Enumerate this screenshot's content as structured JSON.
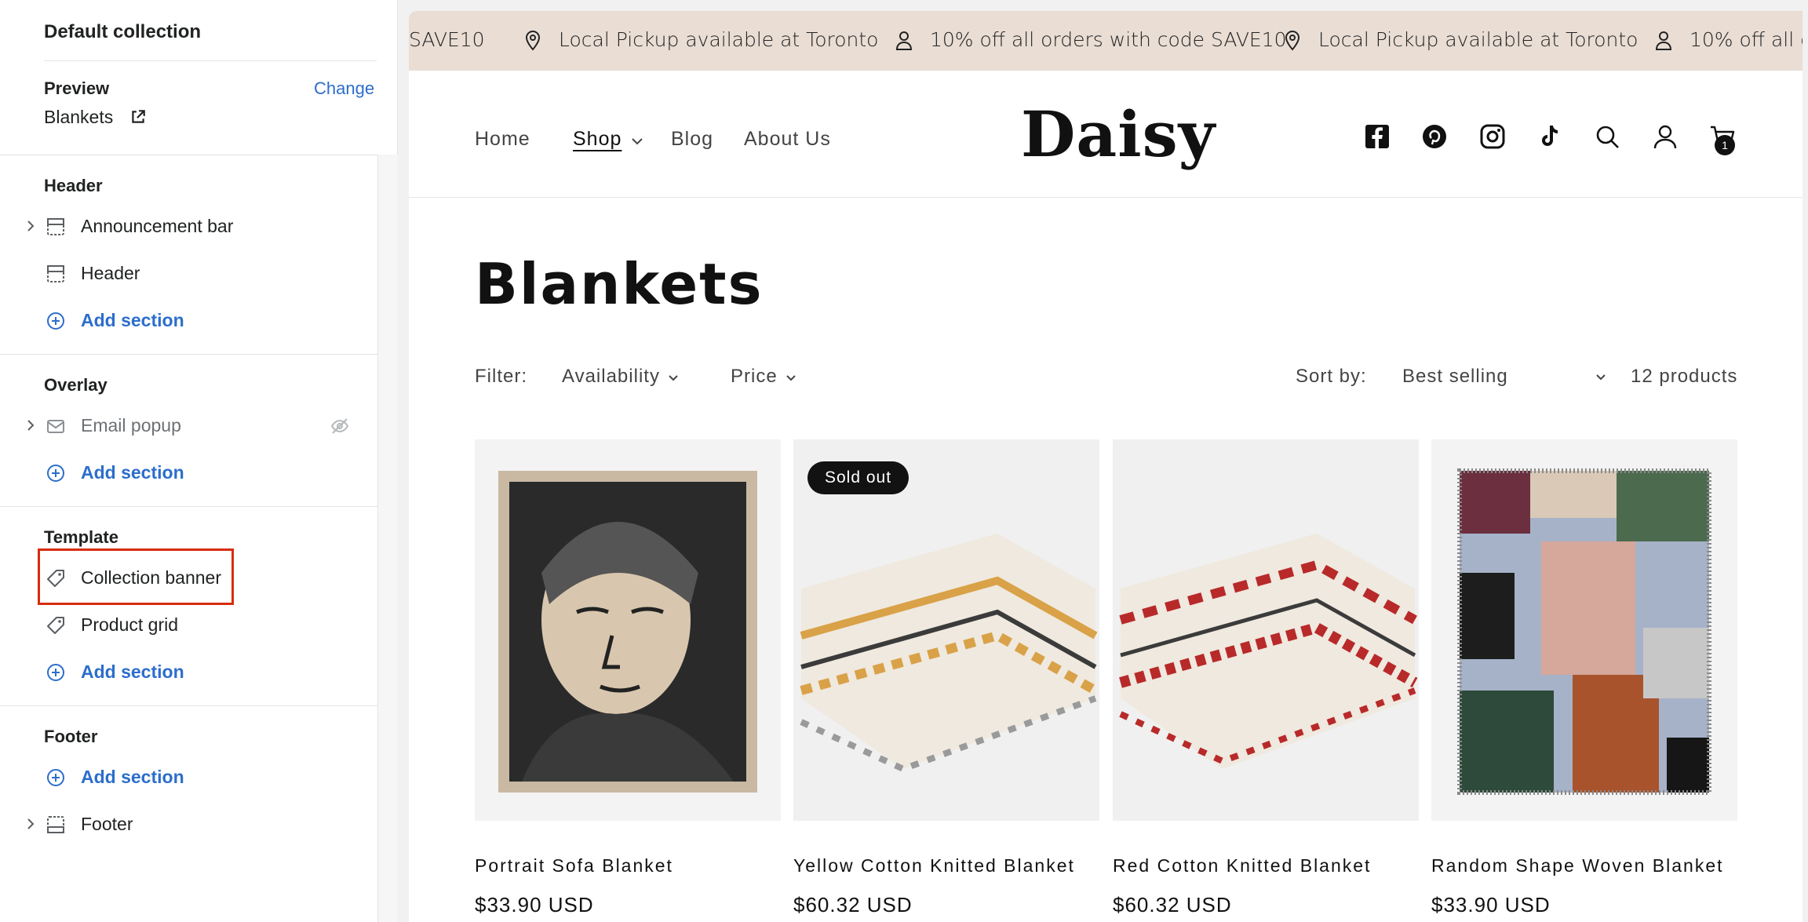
{
  "sidebar": {
    "collection_title": "Default collection",
    "preview_label": "Preview",
    "change_label": "Change",
    "preview_page": "Blankets",
    "sections": [
      {
        "title": "Header",
        "items": [
          {
            "label": "Announcement bar",
            "icon": "layout-header-icon",
            "expandable": true
          },
          {
            "label": "Header",
            "icon": "layout-header-icon",
            "expandable": false
          }
        ],
        "add_label": "Add section"
      },
      {
        "title": "Overlay",
        "items": [
          {
            "label": "Email popup",
            "icon": "envelope-icon",
            "expandable": true,
            "hidden": true
          }
        ],
        "add_label": "Add section"
      },
      {
        "title": "Template",
        "items": [
          {
            "label": "Collection banner",
            "icon": "tag-icon",
            "selected": true
          },
          {
            "label": "Product grid",
            "icon": "tag-icon"
          }
        ],
        "add_label": "Add section"
      },
      {
        "title": "Footer",
        "add_label": "Add section",
        "items": [
          {
            "label": "Footer",
            "icon": "layout-footer-icon",
            "expandable": true
          }
        ]
      }
    ]
  },
  "store": {
    "announcements": [
      "SAVE10",
      "Local Pickup available at Toronto",
      "10% off all orders with code SAVE10",
      "Local Pickup available at Toronto",
      "10% off all orders with code SAVE10"
    ],
    "logo": "Daisy",
    "nav": [
      "Home",
      "Shop",
      "Blog",
      "About Us"
    ],
    "cart_count": "1",
    "page_title": "Blankets",
    "filter_label": "Filter:",
    "filters": [
      "Availability",
      "Price"
    ],
    "sort_label": "Sort by:",
    "sort_value": "Best selling",
    "product_count": "12 products",
    "products": [
      {
        "name": "Portrait Sofa Blanket",
        "price": "$33.90 USD",
        "badge": ""
      },
      {
        "name": "Yellow Cotton Knitted Blanket",
        "price": "$60.32 USD",
        "badge": "Sold out"
      },
      {
        "name": "Red Cotton Knitted Blanket",
        "price": "$60.32 USD",
        "badge": ""
      },
      {
        "name": "Random Shape Woven Blanket",
        "price": "$33.90 USD",
        "badge": ""
      }
    ],
    "colors": {
      "announcement_bg": "#e9ddd4",
      "link_blue": "#2c6ecb",
      "highlight_red": "#d72c0d"
    }
  }
}
